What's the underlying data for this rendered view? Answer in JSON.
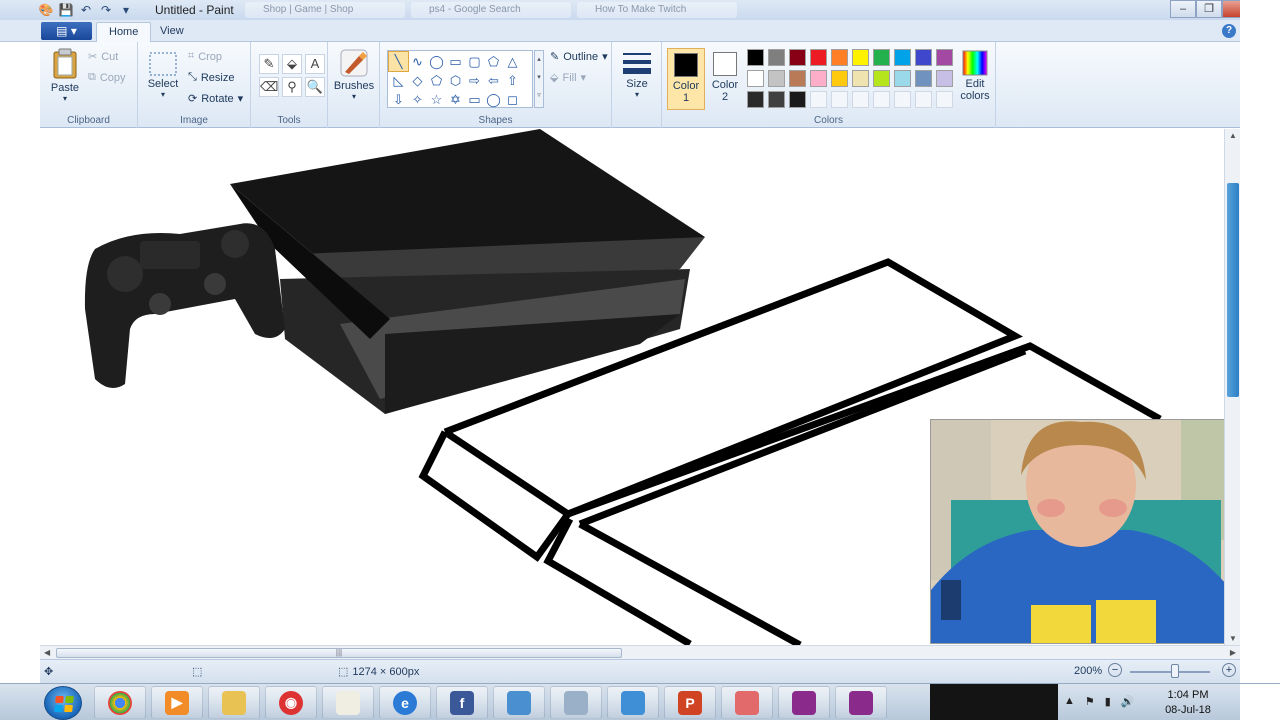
{
  "window": {
    "title": "Untitled - Paint",
    "background_tabs": [
      "Shop | Game | Shop",
      "ps4 - Google Search",
      "How To Make Twitch"
    ],
    "minimize": "–",
    "maximize": "❐",
    "close": "✕"
  },
  "ribbon_tabs": {
    "app_menu": "▤ ▾",
    "home": "Home",
    "view": "View",
    "help": "?"
  },
  "clipboard": {
    "paste": "Paste",
    "cut": "Cut",
    "copy": "Copy",
    "group": "Clipboard"
  },
  "image": {
    "select": "Select",
    "crop": "Crop",
    "resize": "Resize",
    "rotate": "Rotate",
    "group": "Image"
  },
  "tools": {
    "group": "Tools",
    "items": [
      "✎",
      "⬙",
      "A",
      "⌫",
      "⚲",
      "🔍"
    ]
  },
  "brushes": {
    "label": "Brushes"
  },
  "shapes": {
    "group": "Shapes",
    "outline": "Outline",
    "fill": "Fill",
    "items": [
      "╲",
      "∿",
      "◯",
      "▭",
      "▢",
      "⬠",
      "△",
      "◺",
      "◇",
      "⬠",
      "⬡",
      "⇨",
      "⇦",
      "⇧",
      "⇩",
      "✧",
      "☆",
      "✡",
      "▭",
      "◯",
      "◻"
    ]
  },
  "size": {
    "label": "Size"
  },
  "colors": {
    "group": "Colors",
    "color1_label": "Color",
    "color1_num": "1",
    "color2_label": "Color",
    "color2_num": "2",
    "color1": "#000000",
    "color2": "#ffffff",
    "edit": "Edit colors",
    "palette": [
      "#000000",
      "#7f7f7f",
      "#880015",
      "#ed1c24",
      "#ff7f27",
      "#fff200",
      "#22b14c",
      "#00a2e8",
      "#3f48cc",
      "#a349a4",
      "#ffffff",
      "#c3c3c3",
      "#b97a57",
      "#ffaec9",
      "#ffc90e",
      "#efe4b0",
      "#b5e61d",
      "#99d9ea",
      "#7092be",
      "#c8bfe7",
      "#2a2a2a",
      "#404040",
      "#1a1a1a",
      "",
      "",
      "",
      "",
      "",
      "",
      ""
    ]
  },
  "status": {
    "move_icon": "✥",
    "select_icon": "⬚",
    "canvas_size": "1274 × 600px",
    "zoom": "200%",
    "zoom_out": "−",
    "zoom_in": "+"
  },
  "taskbar": {
    "apps": [
      "chrome",
      "media-player",
      "file-explorer",
      "webcam",
      "paint",
      "internet-explorer",
      "facebook",
      "control-panel",
      "calculator",
      "photo-viewer",
      "powerpoint",
      "snipping-tool",
      "meeting-app-1",
      "meeting-app-2"
    ],
    "labels": [
      "",
      "▶",
      "",
      "◉",
      "",
      "e",
      "f",
      "",
      "",
      "",
      "P",
      "",
      "",
      ""
    ],
    "time": "1:04 PM",
    "date": "08-Jul-18"
  }
}
